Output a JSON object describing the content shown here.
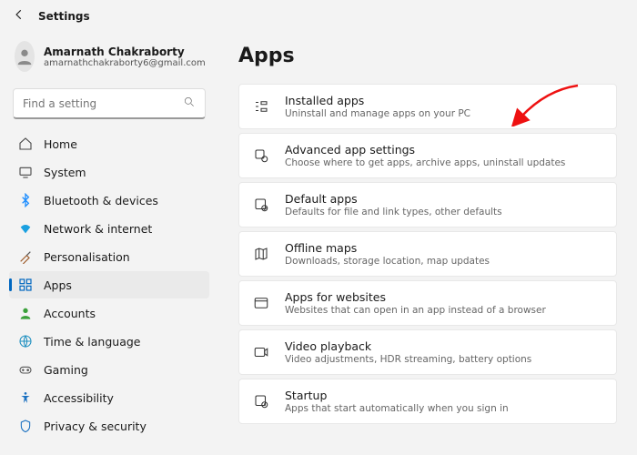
{
  "window": {
    "title": "Settings"
  },
  "user": {
    "name": "Amarnath Chakraborty",
    "email": "amarnathchakraborty6@gmail.com"
  },
  "search": {
    "placeholder": "Find a setting"
  },
  "nav": [
    {
      "label": "Home"
    },
    {
      "label": "System"
    },
    {
      "label": "Bluetooth & devices"
    },
    {
      "label": "Network & internet"
    },
    {
      "label": "Personalisation"
    },
    {
      "label": "Apps"
    },
    {
      "label": "Accounts"
    },
    {
      "label": "Time & language"
    },
    {
      "label": "Gaming"
    },
    {
      "label": "Accessibility"
    },
    {
      "label": "Privacy & security"
    }
  ],
  "page": {
    "title": "Apps"
  },
  "cards": [
    {
      "title": "Installed apps",
      "desc": "Uninstall and manage apps on your PC"
    },
    {
      "title": "Advanced app settings",
      "desc": "Choose where to get apps, archive apps, uninstall updates"
    },
    {
      "title": "Default apps",
      "desc": "Defaults for file and link types, other defaults"
    },
    {
      "title": "Offline maps",
      "desc": "Downloads, storage location, map updates"
    },
    {
      "title": "Apps for websites",
      "desc": "Websites that can open in an app instead of a browser"
    },
    {
      "title": "Video playback",
      "desc": "Video adjustments, HDR streaming, battery options"
    },
    {
      "title": "Startup",
      "desc": "Apps that start automatically when you sign in"
    }
  ],
  "colors": {
    "accent": "#0067c0",
    "arrow": "#e11"
  }
}
